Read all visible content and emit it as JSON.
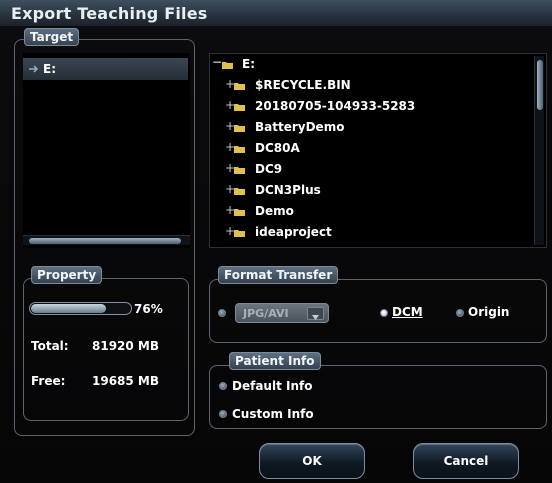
{
  "dialog": {
    "title": "Export Teaching Files"
  },
  "target": {
    "label": "Target",
    "items": [
      {
        "label": "E:",
        "selected": true
      }
    ]
  },
  "tree": {
    "root": "E:",
    "children": [
      "$RECYCLE.BIN",
      "20180705-104933-5283",
      "BatteryDemo",
      "DC80A",
      "DC9",
      "DCN3Plus",
      "Demo",
      "ideaproject"
    ]
  },
  "property": {
    "label": "Property",
    "usage_percent": 76,
    "usage_text": "76%",
    "total_label": "Total:",
    "total_value": "81920 MB",
    "free_label": "Free:",
    "free_value": "19685 MB"
  },
  "format_transfer": {
    "label": "Format Transfer",
    "jpg_option": "JPG/AVI",
    "dcm_option": "DCM",
    "origin_option": "Origin",
    "selected": "DCM"
  },
  "patient_info": {
    "label": "Patient Info",
    "default_option": "Default Info",
    "custom_option": "Custom Info"
  },
  "buttons": {
    "ok": "OK",
    "cancel": "Cancel"
  },
  "colors": {
    "dialog_bg": "#050506",
    "title_bar": "#2c3845",
    "group_border": "#5b6470",
    "selection_bg": "#303b46",
    "progress_fill": "#a9b8c6"
  },
  "icons": {
    "folder": "folder-icon",
    "expand": "plus-icon",
    "collapse": "minus-icon",
    "drive_arrow": "arrow-icon"
  }
}
